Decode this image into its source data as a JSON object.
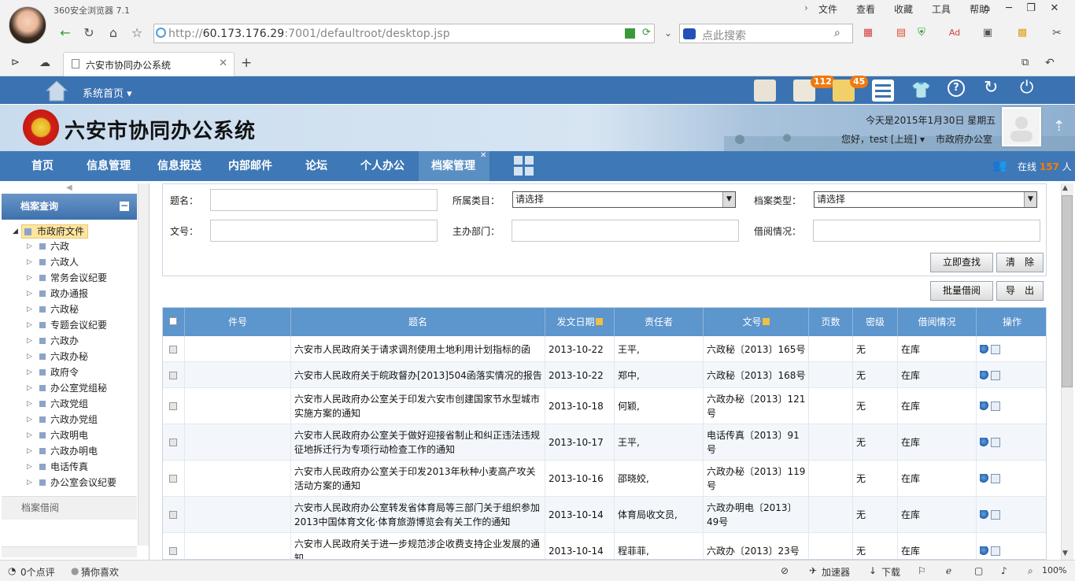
{
  "browser": {
    "app_name": "360安全浏览器 7.1",
    "menu": [
      "文件",
      "查看",
      "收藏",
      "工具",
      "帮助"
    ],
    "url_prefix": "http://",
    "url_host": "60.173.176.29",
    "url_rest": ":7001/defaultroot/desktop.jsp",
    "search_placeholder": "点此搜索",
    "tab_title": "六安市协同办公系统",
    "new_tab": "+"
  },
  "app": {
    "sys_home": "系统首页",
    "title": "六安市协同办公系统",
    "badges": {
      "docs": "112",
      "mail": "45"
    },
    "date_text": "今天是2015年1月30日 星期五",
    "greeting": "您好，test [上班]",
    "department": "市政府办公室",
    "online_prefix": "在线",
    "online_count": "157",
    "online_suffix": "人",
    "nav": [
      "首页",
      "信息管理",
      "信息报送",
      "内部邮件",
      "论坛",
      "个人办公",
      "档案管理"
    ]
  },
  "sidebar": {
    "header": "档案查询",
    "root": "市政府文件",
    "items": [
      "六政",
      "六政人",
      "常务会议纪要",
      "政办通报",
      "六政秘",
      "专题会议纪要",
      "六政办",
      "六政办秘",
      "政府令",
      "办公室党组秘",
      "六政党组",
      "六政办党组",
      "六政明电",
      "六政办明电",
      "电话传真",
      "办公室会议纪要"
    ],
    "footer": "档案借阅"
  },
  "form": {
    "title_label": "题名：",
    "category_label": "所属类目：",
    "type_label": "档案类型：",
    "docno_label": "文号：",
    "dept_label": "主办部门：",
    "borrow_label": "借阅情况：",
    "select_placeholder": "请选择",
    "search_btn": "立即查找",
    "clear_btn": "清　除",
    "batch_btn": "批量借阅",
    "export_btn": "导　出"
  },
  "table": {
    "headers": [
      "件号",
      "题名",
      "发文日期",
      "责任者",
      "文号",
      "页数",
      "密级",
      "借阅情况",
      "操作"
    ],
    "rows": [
      {
        "title": "六安市人民政府关于请求调剂使用土地利用计划指标的函",
        "date": "2013-10-22",
        "owner": "王平,",
        "docno": "六政秘〔2013〕165号",
        "secret": "无",
        "status": "在库"
      },
      {
        "title": "六安市人民政府关于皖政督办[2013]504函落实情况的报告",
        "date": "2013-10-22",
        "owner": "郑中,",
        "docno": "六政秘〔2013〕168号",
        "secret": "无",
        "status": "在库"
      },
      {
        "title": "六安市人民政府办公室关于印发六安市创建国家节水型城市实施方案的通知",
        "date": "2013-10-18",
        "owner": "何颖,",
        "docno": "六政办秘〔2013〕121号",
        "secret": "无",
        "status": "在库"
      },
      {
        "title": "六安市人民政府办公室关于做好迎接省制止和纠正违法违规征地拆迁行为专项行动检查工作的通知",
        "date": "2013-10-17",
        "owner": "王平,",
        "docno": "电话传真〔2013〕91号",
        "secret": "无",
        "status": "在库"
      },
      {
        "title": "六安市人民政府办公室关于印发2013年秋种小麦高产攻关活动方案的通知",
        "date": "2013-10-16",
        "owner": "邵晓姣,",
        "docno": "六政办秘〔2013〕119号",
        "secret": "无",
        "status": "在库"
      },
      {
        "title": "六安市人民政府办公室转发省体育局等三部门关于组织参加2013中国体育文化·体育旅游博览会有关工作的通知",
        "date": "2013-10-14",
        "owner": "体育局收文员,",
        "docno": "六政办明电〔2013〕49号",
        "secret": "无",
        "status": "在库"
      },
      {
        "title": "六安市人民政府关于进一步规范涉企收费支持企业发展的通知",
        "date": "2013-10-14",
        "owner": "程菲菲,",
        "docno": "六政办〔2013〕23号",
        "secret": "无",
        "status": "在库"
      }
    ]
  },
  "statusbar": {
    "comments": "0个点评",
    "guess": "猜你喜欢",
    "accelerator": "加速器",
    "download": "下载",
    "zoom": "100%"
  },
  "colors": {
    "brand_blue": "#3b74b4",
    "header_blue": "#5d95cd",
    "badge_orange": "#f07a10",
    "tree_highlight": "#ffe59e"
  }
}
